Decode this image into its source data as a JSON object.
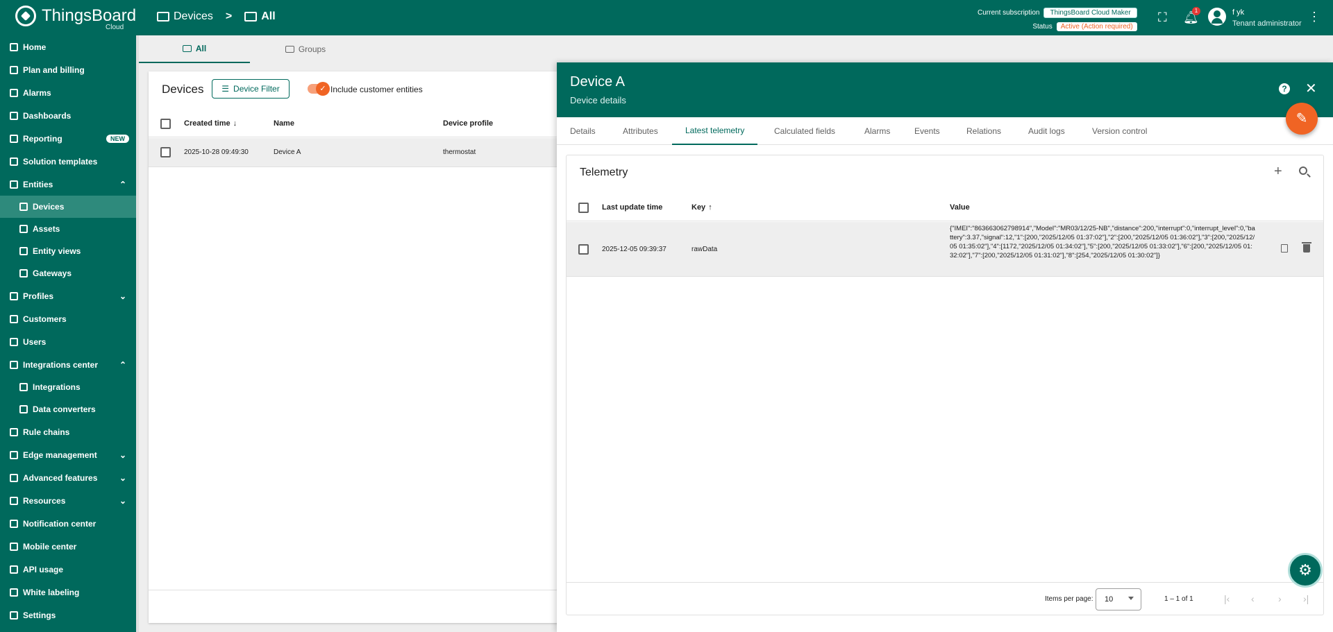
{
  "topbar": {
    "logo_text": "ThingsBoard",
    "logo_sub": "Cloud",
    "breadcrumb": [
      "Devices",
      ">",
      "All"
    ],
    "subscription_label": "Current subscription",
    "subscription_value": "ThingsBoard Cloud Maker",
    "status_label": "Status",
    "status_value": "Active (Action required)",
    "notification_count": "1",
    "user_name": "f yk",
    "user_role": "Tenant administrator"
  },
  "sidebar": {
    "items": [
      {
        "label": "Home",
        "icon": "home-icon"
      },
      {
        "label": "Plan and billing",
        "icon": "billing-icon"
      },
      {
        "label": "Alarms",
        "icon": "alarm-icon"
      },
      {
        "label": "Dashboards",
        "icon": "dashboard-icon"
      },
      {
        "label": "Reporting",
        "icon": "report-icon",
        "badge": "NEW"
      },
      {
        "label": "Solution templates",
        "icon": "grid-icon"
      },
      {
        "label": "Entities",
        "icon": "entities-icon",
        "expanded": true
      },
      {
        "label": "Devices",
        "icon": "device-icon",
        "active": true,
        "sub": true
      },
      {
        "label": "Assets",
        "icon": "asset-icon",
        "sub": true
      },
      {
        "label": "Entity views",
        "icon": "entity-view-icon",
        "sub": true
      },
      {
        "label": "Gateways",
        "icon": "gateway-icon",
        "sub": true
      },
      {
        "label": "Profiles",
        "icon": "profile-icon",
        "collapsed": true
      },
      {
        "label": "Customers",
        "icon": "customers-icon"
      },
      {
        "label": "Users",
        "icon": "user-icon"
      },
      {
        "label": "Integrations center",
        "icon": "integrations-icon",
        "expanded": true
      },
      {
        "label": "Integrations",
        "icon": "integration-icon",
        "sub": true
      },
      {
        "label": "Data converters",
        "icon": "converter-icon",
        "sub": true
      },
      {
        "label": "Rule chains",
        "icon": "rule-chain-icon"
      },
      {
        "label": "Edge management",
        "icon": "edge-icon",
        "collapsed": true
      },
      {
        "label": "Advanced features",
        "icon": "advanced-icon",
        "collapsed": true
      },
      {
        "label": "Resources",
        "icon": "resources-icon",
        "collapsed": true
      },
      {
        "label": "Notification center",
        "icon": "notification-icon"
      },
      {
        "label": "Mobile center",
        "icon": "mobile-icon"
      },
      {
        "label": "API usage",
        "icon": "api-icon"
      },
      {
        "label": "White labeling",
        "icon": "brush-icon"
      },
      {
        "label": "Settings",
        "icon": "settings-icon"
      }
    ]
  },
  "main_tabs": [
    "All",
    "Groups"
  ],
  "devices_panel": {
    "title": "Devices",
    "filter_button": "Device Filter",
    "toggle_label": "Include customer entities",
    "columns": [
      "Created time",
      "Name",
      "Device profile"
    ],
    "rows": [
      {
        "created": "2025-10-28 09:49:30",
        "name": "Device A",
        "profile": "thermostat"
      }
    ]
  },
  "drawer": {
    "title": "Device A",
    "subtitle": "Device details",
    "tabs": [
      "Details",
      "Attributes",
      "Latest telemetry",
      "Calculated fields",
      "Alarms",
      "Events",
      "Relations",
      "Audit logs",
      "Version control"
    ],
    "active_tab": "Latest telemetry"
  },
  "telemetry": {
    "title": "Telemetry",
    "columns": [
      "Last update time",
      "Key",
      "Value"
    ],
    "rows": [
      {
        "time": "2025-12-05 09:39:37",
        "key": "rawData",
        "value": "{\"IMEI\":\"863663062798914\",\"Model\":\"MR03/12/25-NB\",\"distance\":200,\"interrupt\":0,\"interrupt_level\":0,\"battery\":3.37,\"signal\":12,\"1\":[200,\"2025/12/05 01:37:02\"],\"2\":[200,\"2025/12/05 01:36:02\"],\"3\":[200,\"2025/12/05 01:35:02\"],\"4\":[1172,\"2025/12/05 01:34:02\"],\"5\":[200,\"2025/12/05 01:33:02\"],\"6\":[200,\"2025/12/05 01:32:02\"],\"7\":[200,\"2025/12/05 01:31:02\"],\"8\":[254,\"2025/12/05 01:30:02\"]}"
      }
    ],
    "items_per_page_label": "Items per page:",
    "items_per_page": "10",
    "range": "1 – 1 of 1"
  },
  "colors": {
    "primary": "#00695c",
    "accent": "#f06424"
  }
}
